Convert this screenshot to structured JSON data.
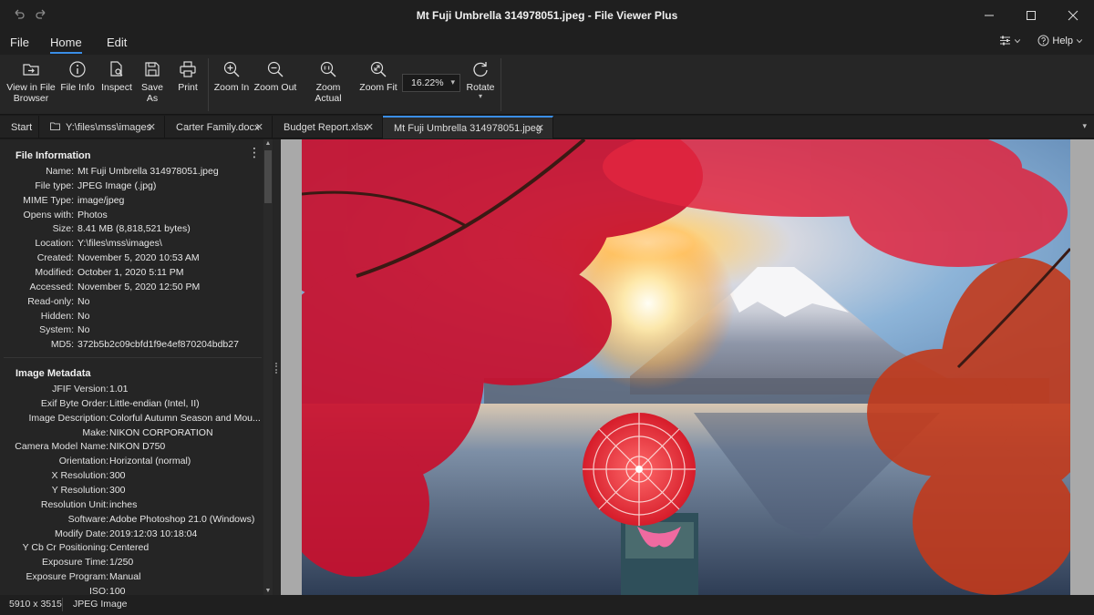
{
  "window": {
    "title": "Mt Fuji Umbrella 314978051.jpeg - File Viewer Plus"
  },
  "menu": {
    "items": [
      "File",
      "Home",
      "Edit"
    ],
    "active": "Home",
    "help_label": "Help"
  },
  "ribbon": {
    "buttons": {
      "view_in_browser": "View in File Browser",
      "file_info": "File Info",
      "inspect": "Inspect",
      "save_as": "Save As",
      "print": "Print",
      "zoom_in": "Zoom In",
      "zoom_out": "Zoom Out",
      "zoom_actual": "Zoom Actual",
      "zoom_fit": "Zoom Fit",
      "rotate": "Rotate"
    },
    "zoom_value": "16.22%"
  },
  "tabs": [
    {
      "label": "Start"
    },
    {
      "label": "Y:\\files\\mss\\images"
    },
    {
      "label": "Carter Family.docx"
    },
    {
      "label": "Budget Report.xlsx"
    },
    {
      "label": "Mt Fuji Umbrella 314978051.jpeg",
      "active": true
    }
  ],
  "file_info": {
    "title": "File Information",
    "rows": [
      {
        "k": "Name:",
        "v": "Mt Fuji Umbrella 314978051.jpeg"
      },
      {
        "k": "File type:",
        "v": "JPEG Image (.jpg)"
      },
      {
        "k": "MIME Type:",
        "v": "image/jpeg"
      },
      {
        "k": "Opens with:",
        "v": "Photos"
      },
      {
        "k": "Size:",
        "v": "8.41 MB (8,818,521 bytes)"
      },
      {
        "k": "Location:",
        "v": "Y:\\files\\mss\\images\\"
      },
      {
        "k": "Created:",
        "v": "November 5, 2020 10:53 AM"
      },
      {
        "k": "Modified:",
        "v": "October 1, 2020 5:11 PM"
      },
      {
        "k": "Accessed:",
        "v": "November 5, 2020 12:50 PM"
      },
      {
        "k": "Read-only:",
        "v": "No"
      },
      {
        "k": "Hidden:",
        "v": "No"
      },
      {
        "k": "System:",
        "v": "No"
      },
      {
        "k": "MD5:",
        "v": "372b5b2c09cbfd1f9e4ef870204bdb27"
      }
    ]
  },
  "image_metadata": {
    "title": "Image Metadata",
    "rows": [
      {
        "k": "JFIF Version:",
        "v": "1.01"
      },
      {
        "k": "Exif Byte Order:",
        "v": "Little-endian (Intel, II)"
      },
      {
        "k": "Image Description:",
        "v": "Colorful Autumn Season and Mou..."
      },
      {
        "k": "Make:",
        "v": "NIKON CORPORATION"
      },
      {
        "k": "Camera Model Name:",
        "v": "NIKON D750"
      },
      {
        "k": "Orientation:",
        "v": "Horizontal (normal)"
      },
      {
        "k": "X Resolution:",
        "v": "300"
      },
      {
        "k": "Y Resolution:",
        "v": "300"
      },
      {
        "k": "Resolution Unit:",
        "v": "inches"
      },
      {
        "k": "Software:",
        "v": "Adobe Photoshop 21.0 (Windows)"
      },
      {
        "k": "Modify Date:",
        "v": "2019:12:03 10:18:04"
      },
      {
        "k": "Y Cb Cr Positioning:",
        "v": "Centered"
      },
      {
        "k": "Exposure Time:",
        "v": "1/250"
      },
      {
        "k": "Exposure Program:",
        "v": "Manual"
      },
      {
        "k": "ISO:",
        "v": "100"
      }
    ]
  },
  "status": {
    "dimensions": "5910 x 3515",
    "type": "JPEG Image"
  },
  "colors": {
    "accent": "#3a8ee6",
    "background": "#1b1b1b",
    "panel": "#252525"
  }
}
